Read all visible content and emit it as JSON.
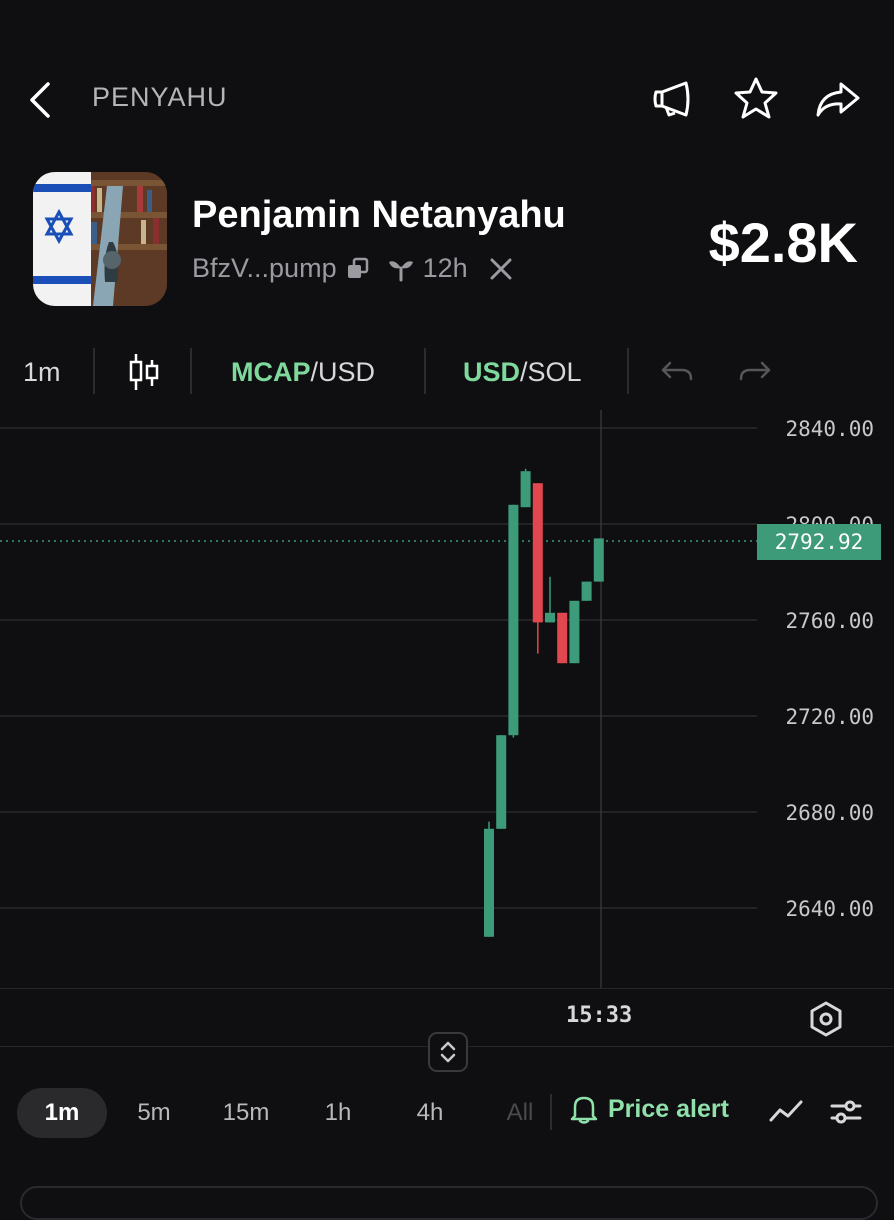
{
  "header": {
    "title": "PENYAHU",
    "icons": [
      "back-icon",
      "megaphone-icon",
      "star-icon",
      "share-icon"
    ]
  },
  "token": {
    "name": "Penjamin Netanyahu",
    "address": "BfzV...pump",
    "age": "12h",
    "market_cap": "$2.8K"
  },
  "toolbar": {
    "interval": "1m",
    "mcap_label": "MCAP",
    "mcap_suffix": "/USD",
    "usd_label": "USD",
    "usd_suffix": "/SOL"
  },
  "chart_data": {
    "type": "candlestick",
    "current_price": "2792.92",
    "y_ticks": [
      "2840.00",
      "2800.00",
      "2760.00",
      "2720.00",
      "2680.00",
      "2640.00"
    ],
    "ylim": [
      2620,
      2848
    ],
    "x_label": "15:33",
    "candles": [
      {
        "open": 2628,
        "close": 2673,
        "high": 2676,
        "low": 2628,
        "dir": "up"
      },
      {
        "open": 2673,
        "close": 2712,
        "high": 2712,
        "low": 2673,
        "dir": "up"
      },
      {
        "open": 2712,
        "close": 2808,
        "high": 2808,
        "low": 2711,
        "dir": "up"
      },
      {
        "open": 2807,
        "close": 2822,
        "high": 2823,
        "low": 2807,
        "dir": "up"
      },
      {
        "open": 2817,
        "close": 2759,
        "high": 2817,
        "low": 2746,
        "dir": "down"
      },
      {
        "open": 2759,
        "close": 2763,
        "high": 2778,
        "low": 2759,
        "dir": "up"
      },
      {
        "open": 2763,
        "close": 2742,
        "high": 2763,
        "low": 2742,
        "dir": "down"
      },
      {
        "open": 2742,
        "close": 2768,
        "high": 2768,
        "low": 2742,
        "dir": "up"
      },
      {
        "open": 2768,
        "close": 2776,
        "high": 2776,
        "low": 2768,
        "dir": "up"
      },
      {
        "open": 2776,
        "close": 2794,
        "high": 2794,
        "low": 2776,
        "dir": "up"
      }
    ],
    "colors": {
      "up": "#3d9b7a",
      "down": "#e0474f"
    },
    "grid": true
  },
  "timeframes": [
    "1m",
    "5m",
    "15m",
    "1h",
    "4h",
    "All"
  ],
  "active_timeframe": "1m",
  "price_alert_label": "Price alert"
}
